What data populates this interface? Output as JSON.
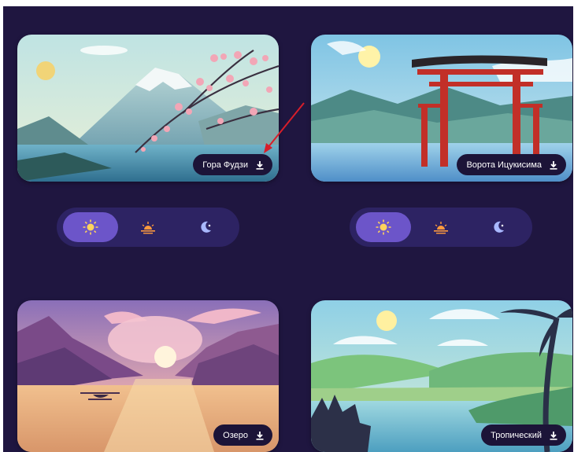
{
  "cards": [
    {
      "id": "fuji",
      "title": "Гора Фудзи",
      "download_icon": "download-icon"
    },
    {
      "id": "gate",
      "title": "Ворота Ицукисима",
      "download_icon": "download-icon"
    },
    {
      "id": "lake",
      "title": "Озеро",
      "download_icon": "download-icon"
    },
    {
      "id": "tropic",
      "title": "Тропический",
      "download_icon": "download-icon"
    }
  ],
  "time_switches": [
    {
      "options": [
        {
          "icon": "sun-icon",
          "active": true
        },
        {
          "icon": "sunset-icon",
          "active": false
        },
        {
          "icon": "moon-icon",
          "active": false
        }
      ]
    },
    {
      "options": [
        {
          "icon": "sun-icon",
          "active": true
        },
        {
          "icon": "sunset-icon",
          "active": false
        },
        {
          "icon": "moon-icon",
          "active": false
        }
      ]
    }
  ],
  "annotation": {
    "arrow_color": "#d81e2a",
    "icon": "red-arrow-annotation"
  },
  "colors": {
    "page_bg": "#1f1640",
    "button_bg": "#1c1438",
    "switch_bg": "#2d2363",
    "switch_active": "#6c55c9",
    "sun_icon": "#ffd35c",
    "sunset_icon": "#ff9a3d",
    "moon_icon": "#a9b8ff"
  }
}
